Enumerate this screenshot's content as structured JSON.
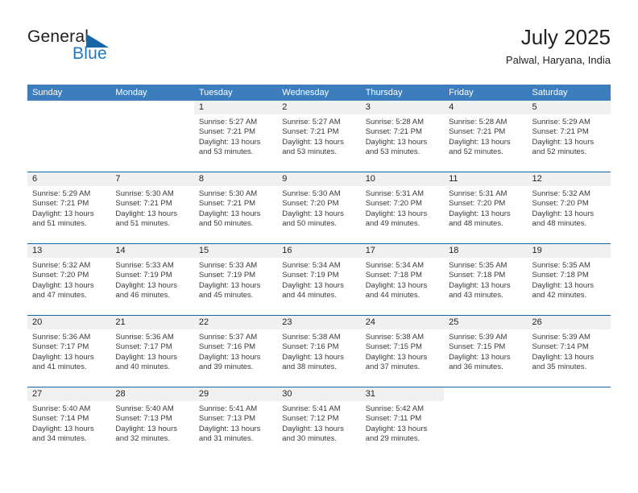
{
  "brand": {
    "name_part1": "General",
    "name_part2": "Blue"
  },
  "header": {
    "title": "July 2025",
    "location": "Palwal, Haryana, India"
  },
  "colors": {
    "header_blue": "#3b7dbd",
    "rule_blue": "#1566a8",
    "daynum_band": "#f0f0f0",
    "logo_blue": "#1f77bd",
    "text": "#231f20"
  },
  "weekdays": [
    "Sunday",
    "Monday",
    "Tuesday",
    "Wednesday",
    "Thursday",
    "Friday",
    "Saturday"
  ],
  "weeks": [
    [
      {
        "day": "",
        "sunrise": "",
        "sunset": "",
        "daylight_line1": "",
        "daylight_line2": ""
      },
      {
        "day": "",
        "sunrise": "",
        "sunset": "",
        "daylight_line1": "",
        "daylight_line2": ""
      },
      {
        "day": "1",
        "sunrise": "Sunrise: 5:27 AM",
        "sunset": "Sunset: 7:21 PM",
        "daylight_line1": "Daylight: 13 hours",
        "daylight_line2": "and 53 minutes."
      },
      {
        "day": "2",
        "sunrise": "Sunrise: 5:27 AM",
        "sunset": "Sunset: 7:21 PM",
        "daylight_line1": "Daylight: 13 hours",
        "daylight_line2": "and 53 minutes."
      },
      {
        "day": "3",
        "sunrise": "Sunrise: 5:28 AM",
        "sunset": "Sunset: 7:21 PM",
        "daylight_line1": "Daylight: 13 hours",
        "daylight_line2": "and 53 minutes."
      },
      {
        "day": "4",
        "sunrise": "Sunrise: 5:28 AM",
        "sunset": "Sunset: 7:21 PM",
        "daylight_line1": "Daylight: 13 hours",
        "daylight_line2": "and 52 minutes."
      },
      {
        "day": "5",
        "sunrise": "Sunrise: 5:29 AM",
        "sunset": "Sunset: 7:21 PM",
        "daylight_line1": "Daylight: 13 hours",
        "daylight_line2": "and 52 minutes."
      }
    ],
    [
      {
        "day": "6",
        "sunrise": "Sunrise: 5:29 AM",
        "sunset": "Sunset: 7:21 PM",
        "daylight_line1": "Daylight: 13 hours",
        "daylight_line2": "and 51 minutes."
      },
      {
        "day": "7",
        "sunrise": "Sunrise: 5:30 AM",
        "sunset": "Sunset: 7:21 PM",
        "daylight_line1": "Daylight: 13 hours",
        "daylight_line2": "and 51 minutes."
      },
      {
        "day": "8",
        "sunrise": "Sunrise: 5:30 AM",
        "sunset": "Sunset: 7:21 PM",
        "daylight_line1": "Daylight: 13 hours",
        "daylight_line2": "and 50 minutes."
      },
      {
        "day": "9",
        "sunrise": "Sunrise: 5:30 AM",
        "sunset": "Sunset: 7:20 PM",
        "daylight_line1": "Daylight: 13 hours",
        "daylight_line2": "and 50 minutes."
      },
      {
        "day": "10",
        "sunrise": "Sunrise: 5:31 AM",
        "sunset": "Sunset: 7:20 PM",
        "daylight_line1": "Daylight: 13 hours",
        "daylight_line2": "and 49 minutes."
      },
      {
        "day": "11",
        "sunrise": "Sunrise: 5:31 AM",
        "sunset": "Sunset: 7:20 PM",
        "daylight_line1": "Daylight: 13 hours",
        "daylight_line2": "and 48 minutes."
      },
      {
        "day": "12",
        "sunrise": "Sunrise: 5:32 AM",
        "sunset": "Sunset: 7:20 PM",
        "daylight_line1": "Daylight: 13 hours",
        "daylight_line2": "and 48 minutes."
      }
    ],
    [
      {
        "day": "13",
        "sunrise": "Sunrise: 5:32 AM",
        "sunset": "Sunset: 7:20 PM",
        "daylight_line1": "Daylight: 13 hours",
        "daylight_line2": "and 47 minutes."
      },
      {
        "day": "14",
        "sunrise": "Sunrise: 5:33 AM",
        "sunset": "Sunset: 7:19 PM",
        "daylight_line1": "Daylight: 13 hours",
        "daylight_line2": "and 46 minutes."
      },
      {
        "day": "15",
        "sunrise": "Sunrise: 5:33 AM",
        "sunset": "Sunset: 7:19 PM",
        "daylight_line1": "Daylight: 13 hours",
        "daylight_line2": "and 45 minutes."
      },
      {
        "day": "16",
        "sunrise": "Sunrise: 5:34 AM",
        "sunset": "Sunset: 7:19 PM",
        "daylight_line1": "Daylight: 13 hours",
        "daylight_line2": "and 44 minutes."
      },
      {
        "day": "17",
        "sunrise": "Sunrise: 5:34 AM",
        "sunset": "Sunset: 7:18 PM",
        "daylight_line1": "Daylight: 13 hours",
        "daylight_line2": "and 44 minutes."
      },
      {
        "day": "18",
        "sunrise": "Sunrise: 5:35 AM",
        "sunset": "Sunset: 7:18 PM",
        "daylight_line1": "Daylight: 13 hours",
        "daylight_line2": "and 43 minutes."
      },
      {
        "day": "19",
        "sunrise": "Sunrise: 5:35 AM",
        "sunset": "Sunset: 7:18 PM",
        "daylight_line1": "Daylight: 13 hours",
        "daylight_line2": "and 42 minutes."
      }
    ],
    [
      {
        "day": "20",
        "sunrise": "Sunrise: 5:36 AM",
        "sunset": "Sunset: 7:17 PM",
        "daylight_line1": "Daylight: 13 hours",
        "daylight_line2": "and 41 minutes."
      },
      {
        "day": "21",
        "sunrise": "Sunrise: 5:36 AM",
        "sunset": "Sunset: 7:17 PM",
        "daylight_line1": "Daylight: 13 hours",
        "daylight_line2": "and 40 minutes."
      },
      {
        "day": "22",
        "sunrise": "Sunrise: 5:37 AM",
        "sunset": "Sunset: 7:16 PM",
        "daylight_line1": "Daylight: 13 hours",
        "daylight_line2": "and 39 minutes."
      },
      {
        "day": "23",
        "sunrise": "Sunrise: 5:38 AM",
        "sunset": "Sunset: 7:16 PM",
        "daylight_line1": "Daylight: 13 hours",
        "daylight_line2": "and 38 minutes."
      },
      {
        "day": "24",
        "sunrise": "Sunrise: 5:38 AM",
        "sunset": "Sunset: 7:15 PM",
        "daylight_line1": "Daylight: 13 hours",
        "daylight_line2": "and 37 minutes."
      },
      {
        "day": "25",
        "sunrise": "Sunrise: 5:39 AM",
        "sunset": "Sunset: 7:15 PM",
        "daylight_line1": "Daylight: 13 hours",
        "daylight_line2": "and 36 minutes."
      },
      {
        "day": "26",
        "sunrise": "Sunrise: 5:39 AM",
        "sunset": "Sunset: 7:14 PM",
        "daylight_line1": "Daylight: 13 hours",
        "daylight_line2": "and 35 minutes."
      }
    ],
    [
      {
        "day": "27",
        "sunrise": "Sunrise: 5:40 AM",
        "sunset": "Sunset: 7:14 PM",
        "daylight_line1": "Daylight: 13 hours",
        "daylight_line2": "and 34 minutes."
      },
      {
        "day": "28",
        "sunrise": "Sunrise: 5:40 AM",
        "sunset": "Sunset: 7:13 PM",
        "daylight_line1": "Daylight: 13 hours",
        "daylight_line2": "and 32 minutes."
      },
      {
        "day": "29",
        "sunrise": "Sunrise: 5:41 AM",
        "sunset": "Sunset: 7:13 PM",
        "daylight_line1": "Daylight: 13 hours",
        "daylight_line2": "and 31 minutes."
      },
      {
        "day": "30",
        "sunrise": "Sunrise: 5:41 AM",
        "sunset": "Sunset: 7:12 PM",
        "daylight_line1": "Daylight: 13 hours",
        "daylight_line2": "and 30 minutes."
      },
      {
        "day": "31",
        "sunrise": "Sunrise: 5:42 AM",
        "sunset": "Sunset: 7:11 PM",
        "daylight_line1": "Daylight: 13 hours",
        "daylight_line2": "and 29 minutes."
      },
      {
        "day": "",
        "sunrise": "",
        "sunset": "",
        "daylight_line1": "",
        "daylight_line2": ""
      },
      {
        "day": "",
        "sunrise": "",
        "sunset": "",
        "daylight_line1": "",
        "daylight_line2": ""
      }
    ]
  ]
}
